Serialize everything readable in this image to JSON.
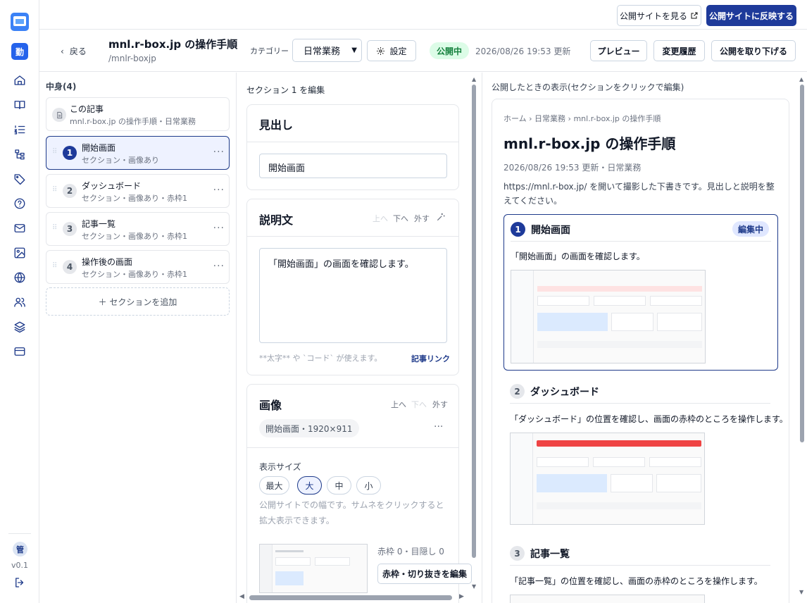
{
  "topbar": {
    "view_site": "公開サイトを見る",
    "publish": "公開サイトに反映する"
  },
  "rail": {
    "app_badge": "勤",
    "user_badge": "管",
    "version": "v0.1"
  },
  "header": {
    "back": "戻る",
    "title": "mnl.r-box.jp の操作手順",
    "slug": "/mnlr-boxjp",
    "category_label": "カテゴリー",
    "category_value": "日常業務",
    "settings": "設定",
    "status": "公開中",
    "updated": "2026/08/26 19:53 更新",
    "preview": "プレビュー",
    "history": "変更履歴",
    "unpublish": "公開を取り下げる"
  },
  "outline": {
    "heading": "中身(4)",
    "article": {
      "title": "この記事",
      "sub": "mnl.r-box.jp の操作手順・日常業務"
    },
    "items": [
      {
        "num": "1",
        "title": "開始画面",
        "sub": "セクション・画像あり"
      },
      {
        "num": "2",
        "title": "ダッシュボード",
        "sub": "セクション・画像あり・赤枠1"
      },
      {
        "num": "3",
        "title": "記事一覧",
        "sub": "セクション・画像あり・赤枠1"
      },
      {
        "num": "4",
        "title": "操作後の画面",
        "sub": "セクション・画像あり・赤枠1"
      }
    ],
    "add": "＋ セクションを追加"
  },
  "editor": {
    "label": "セクション 1 を編集",
    "heading_title": "見出し",
    "heading_value": "開始画面",
    "desc_title": "説明文",
    "up": "上へ",
    "down": "下へ",
    "remove": "外す",
    "desc_value": "「開始画面」の画面を確認します。",
    "hint": "**太字** や `コード` が使えます。",
    "article_link": "記事リンク",
    "image_title": "画像",
    "image_chip": "開始画面・1920×911",
    "size_label": "表示サイズ",
    "sizes": [
      "最大",
      "大",
      "中",
      "小"
    ],
    "size_selected": "大",
    "size_hint": "公開サイトでの幅です。サムネをクリックすると拡大表示できます。",
    "frame_info": "赤枠 0・目隠し 0",
    "edit_frame": "赤枠・切り抜きを編集"
  },
  "preview": {
    "label": "公開したときの表示(セクションをクリックで編集)",
    "breadcrumb": "ホーム › 日常業務 › mnl.r-box.jp の操作手順",
    "title": "mnl.r-box.jp の操作手順",
    "meta": "2026/08/26 19:53 更新・日常業務",
    "intro": "https://mnl.r-box.jp/ を開いて撮影した下書きです。見出しと説明を整えてください。",
    "editing_badge": "編集中",
    "sections": [
      {
        "num": "1",
        "title": "開始画面",
        "text": "「開始画面」の画面を確認します。"
      },
      {
        "num": "2",
        "title": "ダッシュボード",
        "text": "「ダッシュボード」の位置を確認し、画面の赤枠のところを操作します。"
      },
      {
        "num": "3",
        "title": "記事一覧",
        "text": "「記事一覧」の位置を確認し、画面の赤枠のところを操作します。"
      }
    ]
  },
  "colors": {
    "accent": "#1e3a9a",
    "status_green": "#15803d",
    "danger": "#ef4444"
  }
}
